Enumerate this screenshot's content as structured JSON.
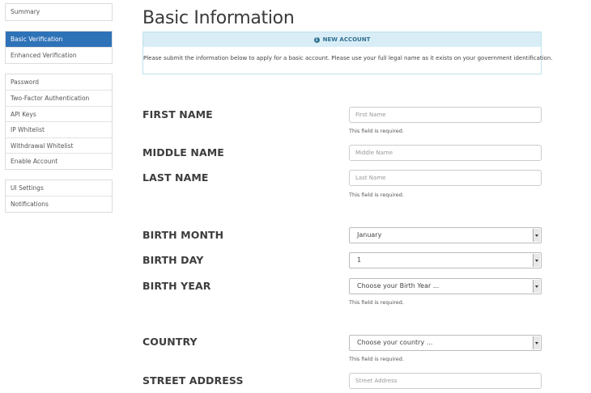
{
  "sidebar": {
    "group1": [
      "Summary"
    ],
    "group2": [
      "Basic Verification",
      "Enhanced Verification"
    ],
    "group3": [
      "Password",
      "Two-Factor Authentication",
      "API Keys",
      "IP Whitelist",
      "Withdrawal Whitelist",
      "Enable Account"
    ],
    "group4": [
      "UI Settings",
      "Notifications"
    ],
    "active": "Basic Verification"
  },
  "page": {
    "title": "Basic Information"
  },
  "alert": {
    "heading": "NEW ACCOUNT",
    "icon": "info-circle-icon",
    "body": "Please submit the information below to apply for a basic account. Please use your full legal name as it exists on your government identification."
  },
  "form": {
    "first_name": {
      "label": "FIRST NAME",
      "placeholder": "First Name",
      "help": "This field is required."
    },
    "middle_name": {
      "label": "MIDDLE NAME",
      "placeholder": "Middle Name"
    },
    "last_name": {
      "label": "LAST NAME",
      "placeholder": "Last Name",
      "help": "This field is required."
    },
    "birth_month": {
      "label": "BIRTH MONTH",
      "value": "January"
    },
    "birth_day": {
      "label": "BIRTH DAY",
      "value": "1"
    },
    "birth_year": {
      "label": "BIRTH YEAR",
      "value": "Choose your Birth Year ...",
      "help": "This field is required."
    },
    "country": {
      "label": "COUNTRY",
      "value": "Choose your country ...",
      "help": "This field is required."
    },
    "street_address": {
      "label": "STREET ADDRESS",
      "placeholder": "Street Address"
    }
  },
  "colors": {
    "active_nav": "#2e72b8",
    "alert_bg": "#d9edf7",
    "alert_text": "#31708f"
  }
}
